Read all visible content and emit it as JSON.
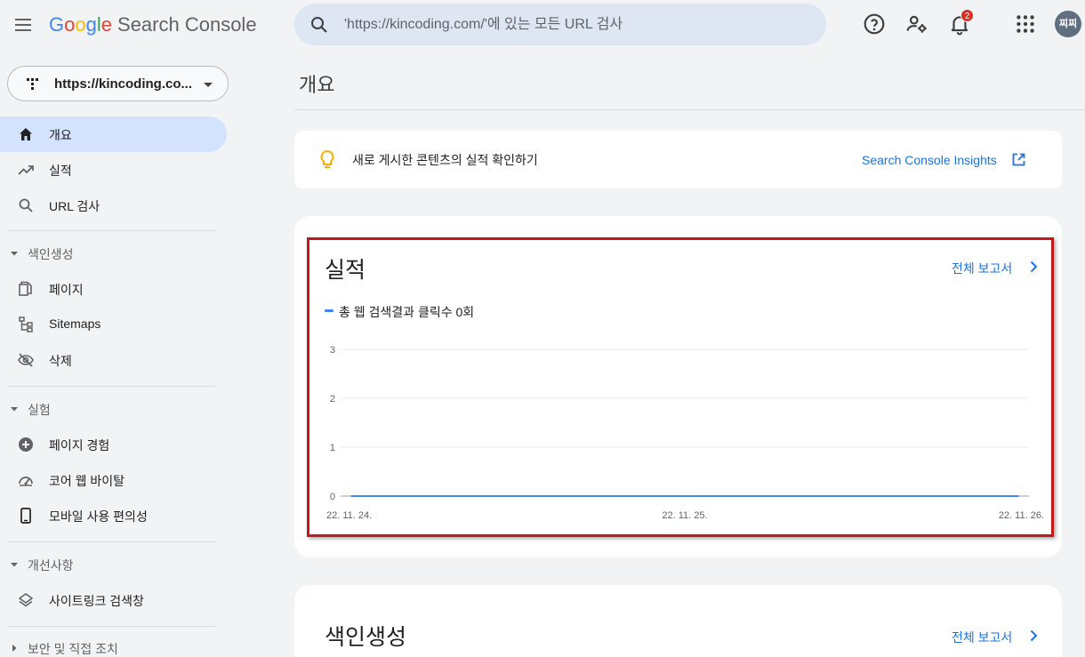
{
  "header": {
    "logo": {
      "G": "G",
      "o1": "o",
      "o2": "o",
      "g": "g",
      "l": "l",
      "e": "e"
    },
    "app_name": "Search Console",
    "search_placeholder": "'https://kincoding.com/'에 있는 모든 URL 검사",
    "notification_count": "2",
    "avatar_label": "찌찌"
  },
  "sidebar": {
    "property": "https://kincoding.co...",
    "items_top": [
      {
        "label": "개요",
        "icon": "home-icon",
        "active": true
      },
      {
        "label": "실적",
        "icon": "trending-up-icon"
      },
      {
        "label": "URL 검사",
        "icon": "search-icon"
      }
    ],
    "section_indexing": {
      "label": "색인생성",
      "items": [
        {
          "label": "페이지",
          "icon": "pages-icon"
        },
        {
          "label": "Sitemaps",
          "icon": "sitemap-icon"
        },
        {
          "label": "삭제",
          "icon": "visibility-off-icon"
        }
      ]
    },
    "section_experience": {
      "label": "실험",
      "items": [
        {
          "label": "페이지 경험",
          "icon": "plus-circle-icon"
        },
        {
          "label": "코어 웹 바이탈",
          "icon": "speedometer-icon"
        },
        {
          "label": "모바일 사용 편의성",
          "icon": "phone-icon"
        }
      ]
    },
    "section_enhancements": {
      "label": "개선사항",
      "items": [
        {
          "label": "사이트링크 검색창",
          "icon": "layers-icon"
        }
      ]
    },
    "section_security": {
      "label": "보안 및 직접 조치"
    }
  },
  "main": {
    "title": "개요",
    "insights": {
      "text": "새로 게시한 콘텐츠의 실적 확인하기",
      "link": "Search Console Insights"
    },
    "performance": {
      "title": "실적",
      "report_link": "전체 보고서"
    },
    "indexing": {
      "title": "색인생성",
      "report_link": "전체 보고서"
    }
  },
  "chart_data": {
    "type": "line",
    "title": "실적",
    "x": [
      "22. 11. 24.",
      "22. 11. 25.",
      "22. 11. 26."
    ],
    "xlabel": "",
    "ylabel": "",
    "yticks": [
      0,
      1,
      2,
      3
    ],
    "ylim": [
      0,
      3
    ],
    "grid": true,
    "legend": "top-left",
    "series": [
      {
        "name": "총 웹 검색결과 클릭수 0회",
        "values": [
          0,
          0,
          0
        ],
        "color": "#4285f4"
      }
    ]
  },
  "colors": {
    "accent": "#1a73e8",
    "active_nav": "#d3e3fd",
    "highlight_border": "#c41919",
    "series": "#4285f4"
  }
}
